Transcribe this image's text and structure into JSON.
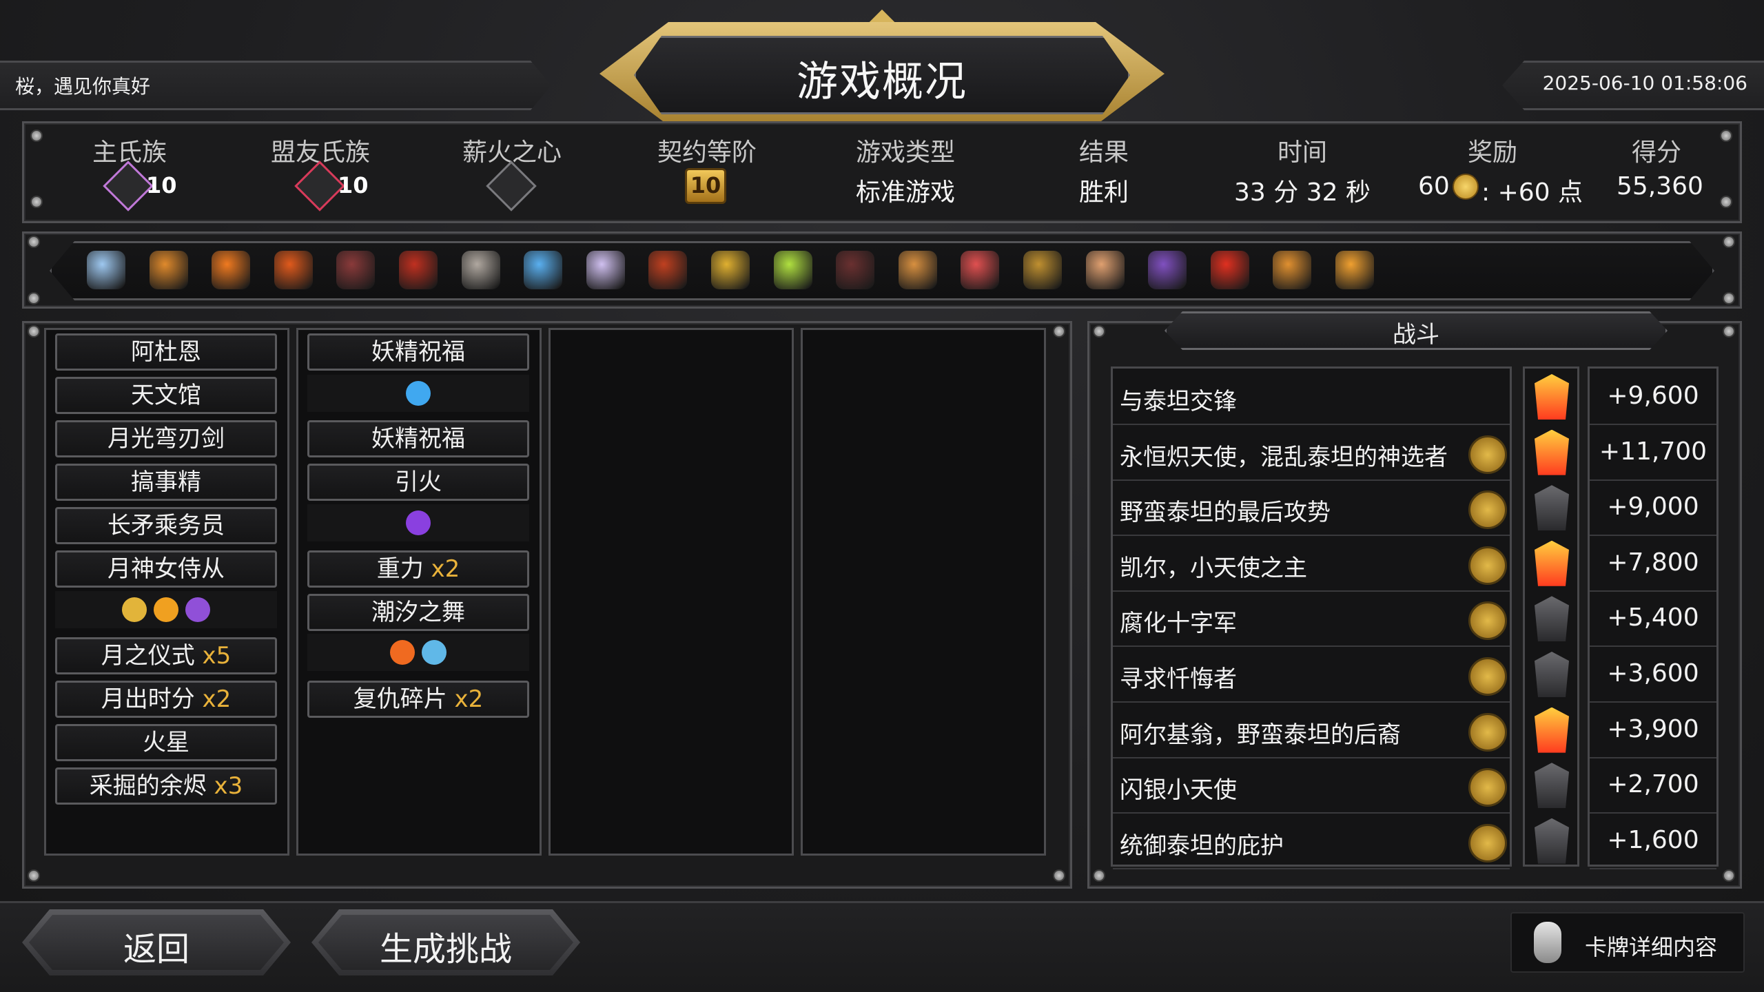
{
  "header": {
    "greeting": "桜，遇见你真好",
    "title": "游戏概况",
    "datetime": "2025-06-10 01:58:06"
  },
  "stats": {
    "labels": [
      "主氏族",
      "盟友氏族",
      "薪火之心",
      "契约等阶",
      "游戏类型",
      "结果",
      "时间",
      "奖励",
      "得分"
    ],
    "main_clan_level": "10",
    "ally_clan_level": "10",
    "covenant_rank": "10",
    "game_type": "标准游戏",
    "result": "胜利",
    "time": "33 分 32 秒",
    "reward_amount": "60",
    "reward_points": ": +60 点",
    "score": "55,360"
  },
  "relic_colors": [
    "#9ec8f0",
    "#e08a2c",
    "#f07a20",
    "#e05a1c",
    "#8a3a3a",
    "#c03020",
    "#b0a8a0",
    "#5ab0f0",
    "#d0c0f0",
    "#c04020",
    "#e0b030",
    "#b0e040",
    "#6a3030",
    "#d89040",
    "#e05050",
    "#c09030",
    "#e0a070",
    "#8050c0",
    "#e03020",
    "#e09030",
    "#f0a030"
  ],
  "deck": {
    "column1": [
      {
        "name": "阿杜恩",
        "mult": ""
      },
      {
        "name": "天文馆",
        "mult": ""
      },
      {
        "name": "月光弯刃剑",
        "mult": ""
      },
      {
        "name": "搞事精",
        "mult": ""
      },
      {
        "name": "长矛乘务员",
        "mult": ""
      },
      {
        "name": "月神女侍从",
        "mult": ""
      },
      {
        "name": "月之仪式",
        "mult": "x5"
      },
      {
        "name": "月出时分",
        "mult": "x2"
      },
      {
        "name": "火星",
        "mult": ""
      },
      {
        "name": "采掘的余烬",
        "mult": "x3"
      }
    ],
    "column2": [
      {
        "name": "妖精祝福",
        "mult": ""
      },
      {
        "name": "妖精祝福",
        "mult": ""
      },
      {
        "name": "引火",
        "mult": ""
      },
      {
        "name": "重力",
        "mult": "x2"
      },
      {
        "name": "潮汐之舞",
        "mult": ""
      },
      {
        "name": "复仇碎片",
        "mult": "x2"
      }
    ]
  },
  "battle": {
    "title": "战斗",
    "rows": [
      {
        "name": "与泰坦交锋",
        "score": "+9,600",
        "boss": "hot",
        "has_icon": false
      },
      {
        "name": "永恒炽天使，混乱泰坦的神选者",
        "score": "+11,700",
        "boss": "hot",
        "has_icon": true
      },
      {
        "name": "野蛮泰坦的最后攻势",
        "score": "+9,000",
        "boss": "cold",
        "has_icon": true
      },
      {
        "name": "凯尔，小天使之主",
        "score": "+7,800",
        "boss": "hot",
        "has_icon": true
      },
      {
        "name": "腐化十字军",
        "score": "+5,400",
        "boss": "cold",
        "has_icon": true
      },
      {
        "name": "寻求忏悔者",
        "score": "+3,600",
        "boss": "cold",
        "has_icon": true
      },
      {
        "name": "阿尔基翁，野蛮泰坦的后裔",
        "score": "+3,900",
        "boss": "hot",
        "has_icon": true
      },
      {
        "name": "闪银小天使",
        "score": "+2,700",
        "boss": "cold",
        "has_icon": true
      },
      {
        "name": "统御泰坦的庇护",
        "score": "+1,600",
        "boss": "cold",
        "has_icon": true
      }
    ]
  },
  "buttons": {
    "back": "返回",
    "generate_challenge": "生成挑战",
    "card_details": "卡牌详细内容"
  }
}
